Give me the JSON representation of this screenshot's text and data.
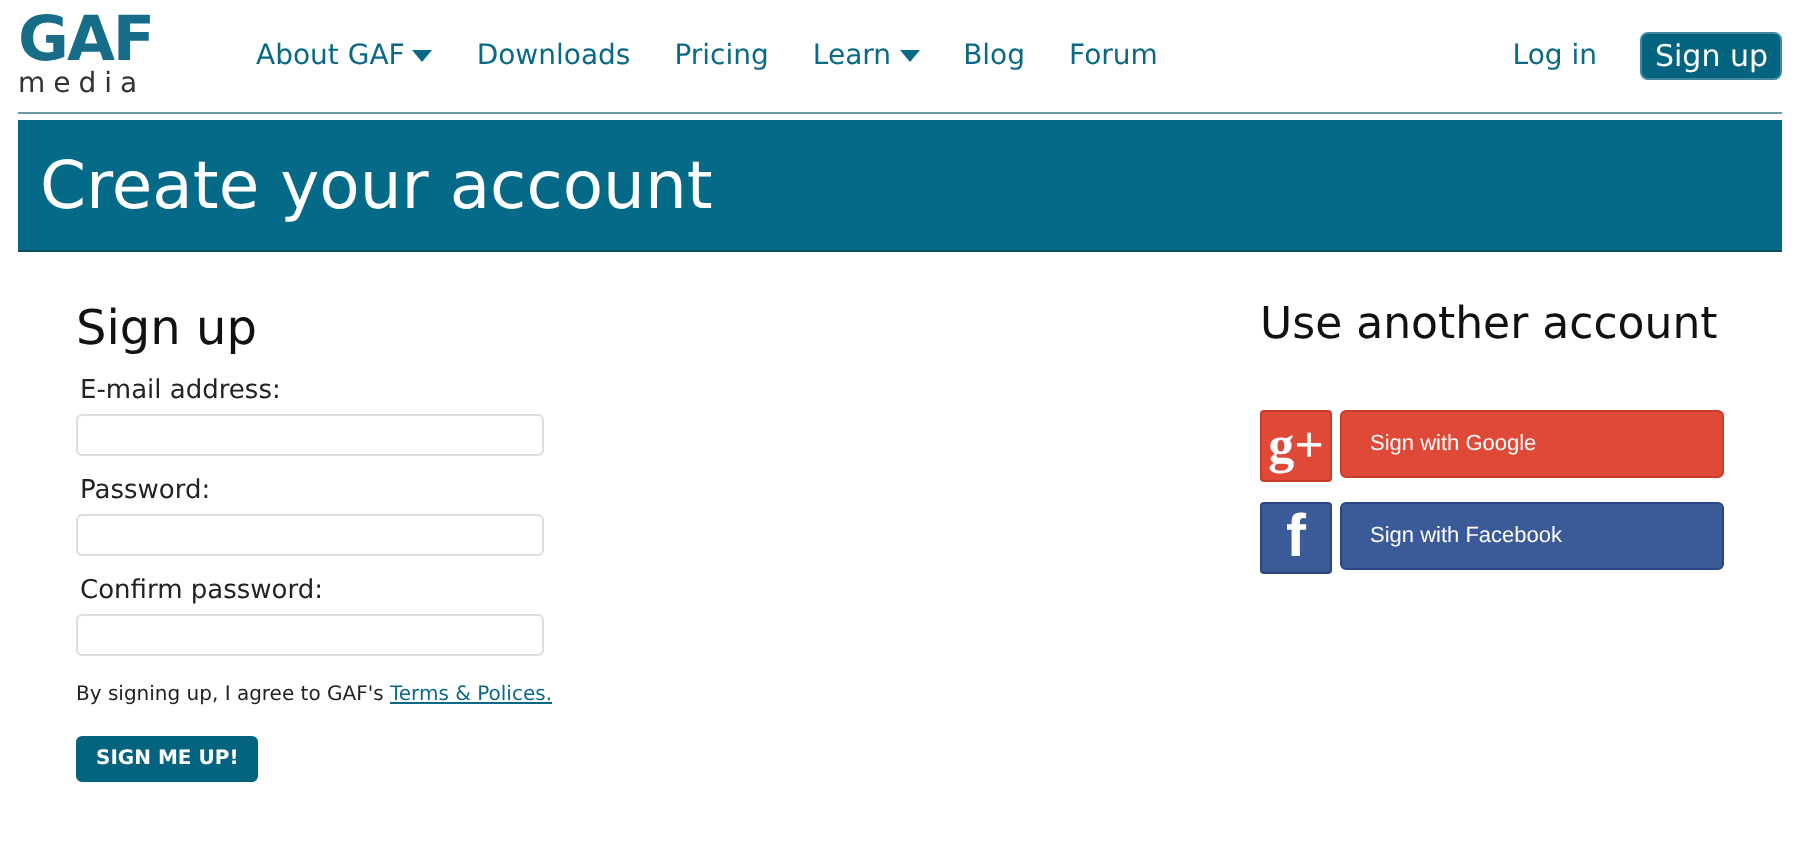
{
  "logo": {
    "main": "GAF",
    "sub": "media"
  },
  "nav": {
    "items": [
      {
        "label": "About GAF",
        "dropdown": true
      },
      {
        "label": "Downloads",
        "dropdown": false
      },
      {
        "label": "Pricing",
        "dropdown": false
      },
      {
        "label": "Learn",
        "dropdown": true
      },
      {
        "label": "Blog",
        "dropdown": false
      },
      {
        "label": "Forum",
        "dropdown": false
      }
    ],
    "login": "Log in",
    "signup": "Sign up"
  },
  "banner": {
    "title": "Create your account"
  },
  "signup_form": {
    "heading": "Sign up",
    "fields": [
      {
        "label": "E-mail address:"
      },
      {
        "label": "Password:"
      },
      {
        "label": "Confirm password:"
      }
    ],
    "agreement": "By signing up, I agree to GAF's",
    "agreement_link": "Terms & Polices.",
    "submit": "SIGN ME UP!"
  },
  "other_accounts": {
    "heading": "Use another account",
    "buttons": [
      {
        "kind": "google",
        "icon": "g+",
        "label": "Sign with Google"
      },
      {
        "kind": "facebook",
        "icon": "f",
        "label": "Sign with Facebook"
      }
    ]
  }
}
